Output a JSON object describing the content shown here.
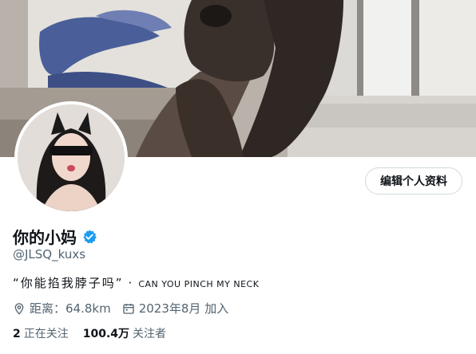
{
  "profile": {
    "display_name": "你的小妈",
    "handle": "@JLSQ_kuxs",
    "bio_quote": "“你能掐我脖子吗”",
    "bio_separator": "·",
    "bio_english": "CAN YOU PINCH MY NECK",
    "location": "距离：64.8km",
    "joined": "2023年8月 加入",
    "following_count": "2",
    "following_label": "正在关注",
    "followers_count": "100.4万",
    "followers_label": "关注者",
    "verified": true
  },
  "actions": {
    "edit_profile_label": "编辑个人资料"
  },
  "colors": {
    "verified_blue": "#1d9bf0",
    "secondary_text": "#536471",
    "border": "#cfd9de"
  },
  "icons": {
    "location": "location-pin-icon",
    "calendar": "calendar-icon",
    "verified": "verified-badge-icon"
  }
}
